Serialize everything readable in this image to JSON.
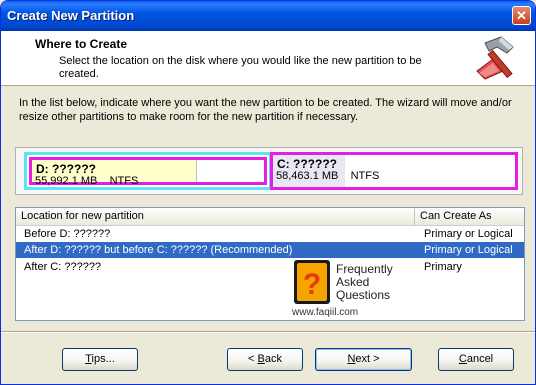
{
  "window": {
    "title": "Create New Partition",
    "close_label": "✕"
  },
  "header": {
    "title": "Where to Create",
    "subtitle": "Select the location on the disk where you would like the new partition to be created.",
    "icon": "hammer-wizard-icon"
  },
  "intro_text": "In the list below, indicate where you want the new partition to be created. The wizard will move and/or resize other partitions to make room for the new partition if necessary.",
  "disk_map": {
    "partitions": [
      {
        "name": "D:  ??????",
        "size": "55,992.1 MB",
        "fs": "NTFS",
        "used_fraction": 0.7
      },
      {
        "name": "C:  ??????",
        "size": "58,463.1 MB",
        "fs": "NTFS",
        "used_fraction": 0.3
      }
    ]
  },
  "list": {
    "columns": [
      "Location for new partition",
      "Can Create As"
    ],
    "rows": [
      {
        "location": "Before D: ??????",
        "type": "Primary or Logical",
        "selected": false
      },
      {
        "location": "After D: ?????? but before C: ??????   (Recommended)",
        "type": "Primary or Logical",
        "selected": true
      },
      {
        "location": "After C: ??????",
        "type": "Primary",
        "selected": false
      }
    ]
  },
  "watermark": {
    "line1": "Frequently",
    "line2": "Asked",
    "line3": "Questions",
    "url": "www.faqiil.com"
  },
  "buttons": {
    "tips": {
      "mnemonic": "T",
      "rest": "ips..."
    },
    "back": {
      "prefix": "< ",
      "mnemonic": "B",
      "rest": "ack"
    },
    "next": {
      "mnemonic": "N",
      "rest": "ext >"
    },
    "cancel": {
      "mnemonic": "C",
      "rest": "ancel"
    }
  },
  "colors": {
    "selection": "#316AC5",
    "partition_border": "#E21FE2",
    "focus_border": "#5CE4F4",
    "titlebar": "#0055E5"
  }
}
